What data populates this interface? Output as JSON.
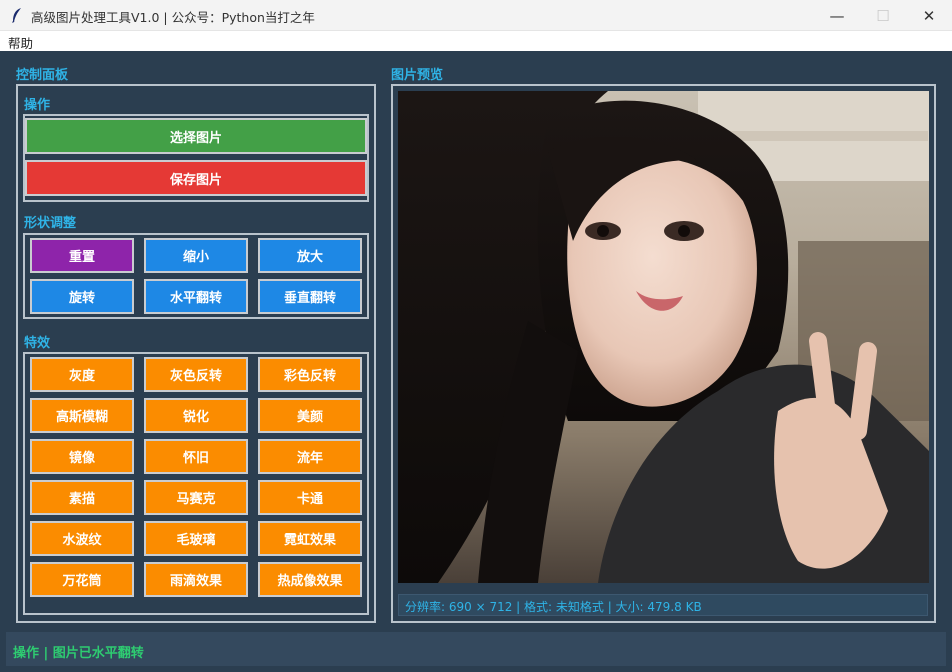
{
  "window": {
    "title": "高级图片处理工具V1.0 | 公众号：Python当打之年",
    "min_glyph": "—",
    "max_glyph": "☐",
    "close_glyph": "✕"
  },
  "menu": {
    "help": "帮助"
  },
  "control_panel": {
    "label": "控制面板",
    "operations": {
      "label": "操作",
      "select_image": "选择图片",
      "save_image": "保存图片"
    },
    "shape": {
      "label": "形状调整",
      "buttons": [
        "重置",
        "缩小",
        "放大",
        "旋转",
        "水平翻转",
        "垂直翻转"
      ]
    },
    "effects": {
      "label": "特效",
      "buttons": [
        "灰度",
        "灰色反转",
        "彩色反转",
        "高斯模糊",
        "锐化",
        "美颜",
        "镜像",
        "怀旧",
        "流年",
        "素描",
        "马赛克",
        "卡通",
        "水波纹",
        "毛玻璃",
        "霓虹效果",
        "万花筒",
        "雨滴效果",
        "热成像效果"
      ]
    }
  },
  "preview": {
    "label": "图片预览",
    "info": "分辨率: 690 × 712 | 格式: 未知格式 | 大小: 479.8 KB"
  },
  "status": {
    "text": "操作 | 图片已水平翻转"
  },
  "colors": {
    "background": "#2b3e50",
    "accent_label": "#2fb3e6",
    "status_green": "#2ecc71",
    "green_button": "#43a047",
    "red_button": "#e53935",
    "purple_button": "#8e24aa",
    "blue_button": "#1e88e5",
    "orange_button": "#fb8c00"
  },
  "icons": {
    "app": "feather-icon",
    "minimize": "minimize-icon",
    "maximize": "maximize-icon",
    "close": "close-icon"
  }
}
